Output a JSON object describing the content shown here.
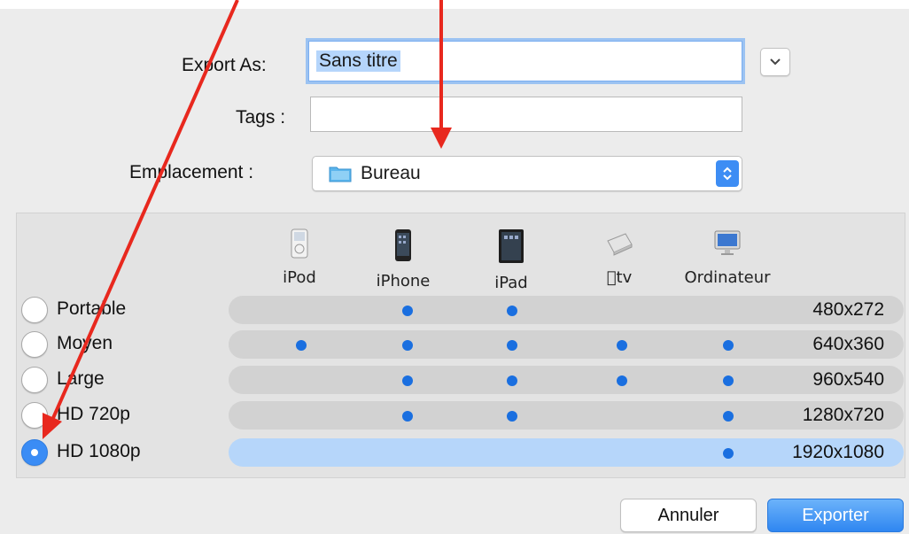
{
  "export_as": {
    "label": "Export As:",
    "value": "Sans titre"
  },
  "tags": {
    "label": "Tags :",
    "value": ""
  },
  "location": {
    "label": "Emplacement :",
    "value": "Bureau",
    "icon": "folder-icon"
  },
  "expand_button": {
    "icon": "chevron-down-icon"
  },
  "devices": [
    {
      "label": "iPod",
      "icon": "ipod-icon"
    },
    {
      "label": "iPhone",
      "icon": "iphone-icon"
    },
    {
      "label": "iPad",
      "icon": "ipad-icon"
    },
    {
      "label": "tv",
      "icon": "appletv-icon"
    },
    {
      "label": "Ordinateur",
      "icon": "computer-icon"
    }
  ],
  "presets": [
    {
      "label": "Portable",
      "resolution": "480x272",
      "checked": false,
      "supports": [
        false,
        true,
        true,
        false,
        false
      ]
    },
    {
      "label": "Moyen",
      "resolution": "640x360",
      "checked": false,
      "supports": [
        true,
        true,
        true,
        true,
        true
      ]
    },
    {
      "label": "Large",
      "resolution": "960x540",
      "checked": false,
      "supports": [
        false,
        true,
        true,
        true,
        true
      ]
    },
    {
      "label": "HD 720p",
      "resolution": "1280x720",
      "checked": false,
      "supports": [
        false,
        true,
        true,
        false,
        true
      ]
    },
    {
      "label": "HD 1080p",
      "resolution": "1920x1080",
      "checked": true,
      "supports": [
        false,
        false,
        false,
        false,
        true
      ]
    }
  ],
  "buttons": {
    "cancel": "Annuler",
    "export": "Exporter"
  },
  "colors": {
    "accent": "#3a8cf5",
    "dot": "#1a6fe0",
    "annotation_arrow": "#e8281e",
    "selected_row": "#b6d6fa"
  }
}
